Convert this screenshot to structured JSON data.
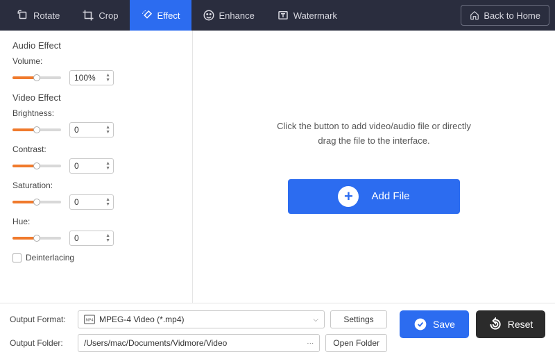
{
  "toolbar": {
    "rotate": "Rotate",
    "crop": "Crop",
    "effect": "Effect",
    "enhance": "Enhance",
    "watermark": "Watermark",
    "back": "Back to Home"
  },
  "left_panel": {
    "audio_section": "Audio Effect",
    "volume_label": "Volume:",
    "volume_value": "100%",
    "video_section": "Video Effect",
    "brightness_label": "Brightness:",
    "brightness_value": "0",
    "contrast_label": "Contrast:",
    "contrast_value": "0",
    "saturation_label": "Saturation:",
    "saturation_value": "0",
    "hue_label": "Hue:",
    "hue_value": "0",
    "deinterlacing_label": "Deinterlacing"
  },
  "drop_area": {
    "hint_line1": "Click the button to add video/audio file or directly",
    "hint_line2": "drag the file to the interface.",
    "add_file": "Add File"
  },
  "bottom": {
    "output_format_label": "Output Format:",
    "output_format_value": "MPEG-4 Video (*.mp4)",
    "settings_btn": "Settings",
    "output_folder_label": "Output Folder:",
    "output_folder_value": "/Users/mac/Documents/Vidmore/Video",
    "open_folder_btn": "Open Folder",
    "save_btn": "Save",
    "reset_btn": "Reset"
  }
}
